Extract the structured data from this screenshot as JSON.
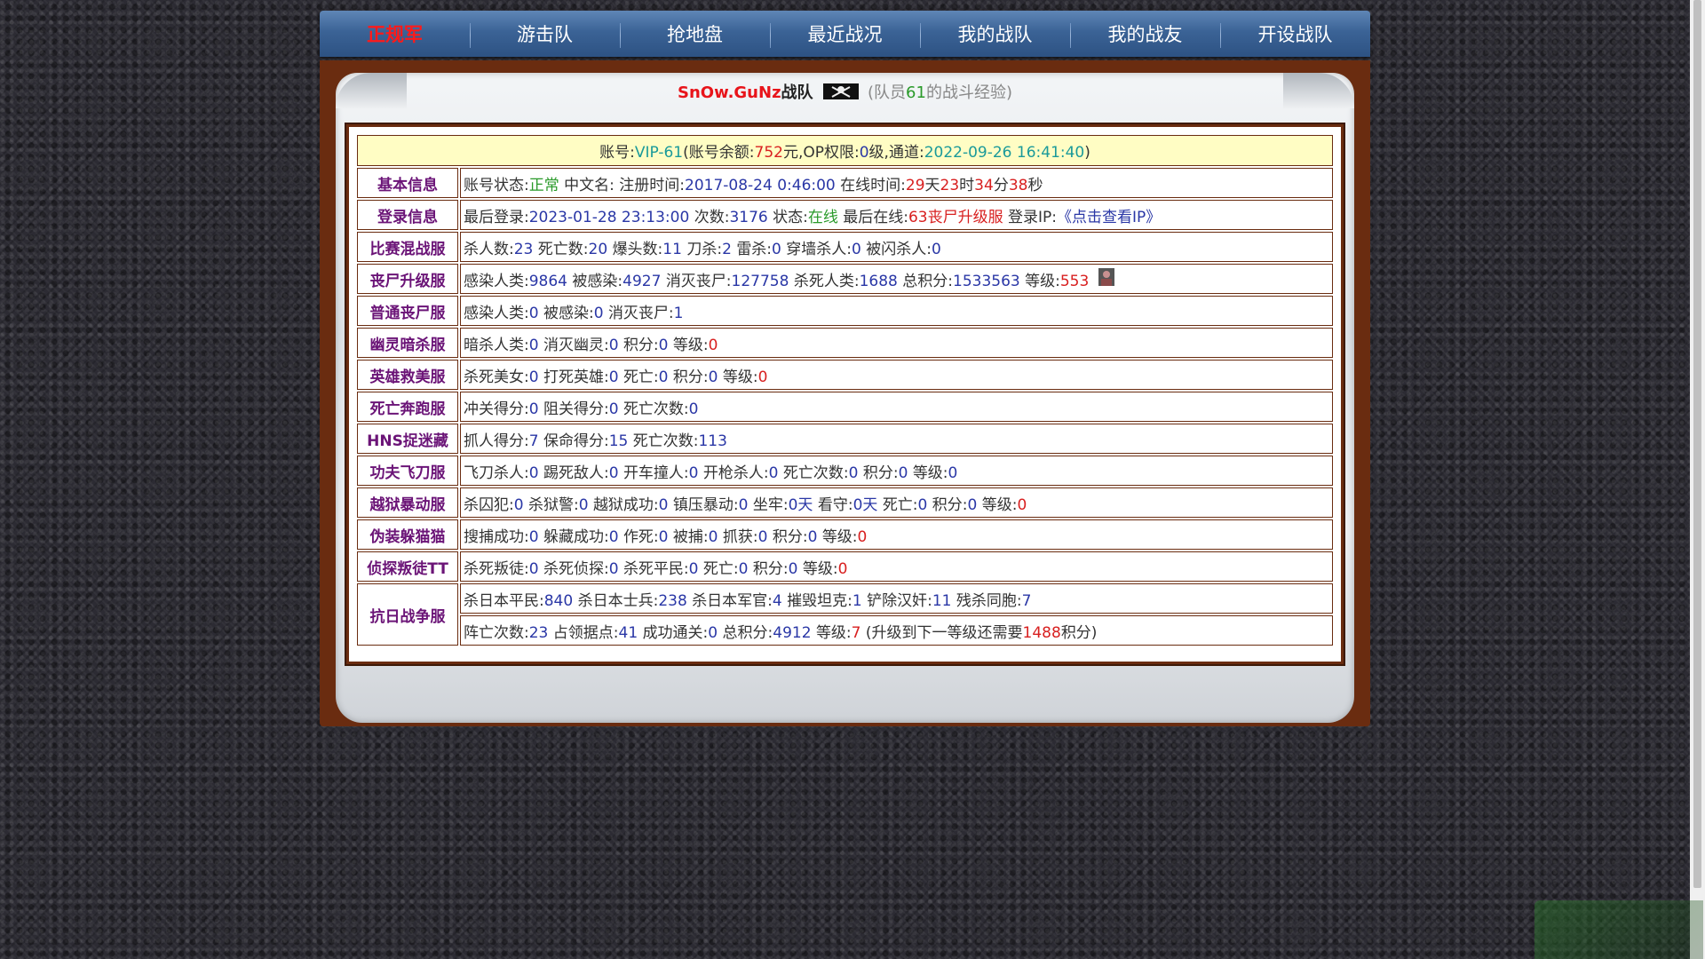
{
  "nav": {
    "items": [
      "正规军",
      "游击队",
      "抢地盘",
      "最近战况",
      "我的战队",
      "我的战友",
      "开设战队"
    ],
    "active_index": 0
  },
  "team": {
    "name": "SnOw.GuNz",
    "suffix": "战队",
    "info_prefix": "(队员",
    "member_id": "61",
    "info_suffix": "的战斗经验)"
  },
  "account": {
    "label1": "账号:",
    "account_id": "VIP-61",
    "label2": "(账号余额:",
    "balance": "752",
    "label3": "元,OP权限:",
    "op_level": "0",
    "label4": "级,通道:",
    "channel_time": "2022-09-26 16:41:40",
    "label5": ")"
  },
  "basic": {
    "caption": "基本信息",
    "status_label": "账号状态:",
    "status": "正常",
    "cn_name_label": "中文名:",
    "reg_label": "注册时间:",
    "reg_time": "2017-08-24 0:46:00",
    "online_label": "在线时间:",
    "days": "29",
    "days_unit": "天",
    "hours": "23",
    "hours_unit": "时",
    "minutes": "34",
    "minutes_unit": "分",
    "seconds": "38",
    "seconds_unit": "秒"
  },
  "login": {
    "caption": "登录信息",
    "last_label": "最后登录:",
    "last_time": "2023-01-28 23:13:00",
    "count_label": "次数:",
    "count": "3176",
    "state_label": "状态:",
    "state": "在线",
    "last_online_label": "最后在线:",
    "last_online": "63丧尸升级服",
    "ip_label": "登录IP:",
    "ip_link": "《点击查看IP》"
  },
  "rows": [
    {
      "caption": "比赛混战服",
      "fields": [
        {
          "label": "杀人数:",
          "value": "23"
        },
        {
          "label": "死亡数:",
          "value": "20"
        },
        {
          "label": "爆头数:",
          "value": "11"
        },
        {
          "label": "刀杀:",
          "value": "2"
        },
        {
          "label": "雷杀:",
          "value": "0"
        },
        {
          "label": "穿墙杀人:",
          "value": "0"
        },
        {
          "label": "被闪杀人:",
          "value": "0"
        }
      ]
    },
    {
      "caption": "丧尸升级服",
      "fields": [
        {
          "label": "感染人类:",
          "value": "9864"
        },
        {
          "label": "被感染:",
          "value": "4927"
        },
        {
          "label": "消灭丧尸:",
          "value": "127758"
        },
        {
          "label": "杀死人类:",
          "value": "1688"
        },
        {
          "label": "总积分:",
          "value": "1533563"
        },
        {
          "label": "等级:",
          "value": "553",
          "red": true
        }
      ],
      "icon": true
    },
    {
      "caption": "普通丧尸服",
      "fields": [
        {
          "label": "感染人类:",
          "value": "0"
        },
        {
          "label": "被感染:",
          "value": "0"
        },
        {
          "label": "消灭丧尸:",
          "value": "1"
        }
      ]
    },
    {
      "caption": "幽灵暗杀服",
      "fields": [
        {
          "label": "暗杀人类:",
          "value": "0"
        },
        {
          "label": "消灭幽灵:",
          "value": "0"
        },
        {
          "label": "积分:",
          "value": "0"
        },
        {
          "label": "等级:",
          "value": "0",
          "red": true
        }
      ]
    },
    {
      "caption": "英雄救美服",
      "fields": [
        {
          "label": "杀死美女:",
          "value": "0"
        },
        {
          "label": "打死英雄:",
          "value": "0"
        },
        {
          "label": "死亡:",
          "value": "0"
        },
        {
          "label": "积分:",
          "value": "0"
        },
        {
          "label": "等级:",
          "value": "0",
          "red": true
        }
      ]
    },
    {
      "caption": "死亡奔跑服",
      "fields": [
        {
          "label": "冲关得分:",
          "value": "0"
        },
        {
          "label": "阻关得分:",
          "value": "0"
        },
        {
          "label": "死亡次数:",
          "value": "0"
        }
      ]
    },
    {
      "caption": "HNS捉迷藏",
      "fields": [
        {
          "label": "抓人得分:",
          "value": "7"
        },
        {
          "label": "保命得分:",
          "value": "15"
        },
        {
          "label": "死亡次数:",
          "value": "113"
        }
      ]
    },
    {
      "caption": "功夫飞刀服",
      "fields": [
        {
          "label": "飞刀杀人:",
          "value": "0"
        },
        {
          "label": "踢死敌人:",
          "value": "0"
        },
        {
          "label": "开车撞人:",
          "value": "0"
        },
        {
          "label": "开枪杀人:",
          "value": "0"
        },
        {
          "label": "死亡次数:",
          "value": "0"
        },
        {
          "label": "积分:",
          "value": "0"
        },
        {
          "label": "等级:",
          "value": "0"
        }
      ]
    },
    {
      "caption": "越狱暴动服",
      "fields": [
        {
          "label": "杀囚犯:",
          "value": "0"
        },
        {
          "label": "杀狱警:",
          "value": "0"
        },
        {
          "label": "越狱成功:",
          "value": "0"
        },
        {
          "label": "镇压暴动:",
          "value": "0"
        },
        {
          "label": "坐牢:",
          "value": "0天"
        },
        {
          "label": "看守:",
          "value": "0天"
        },
        {
          "label": "死亡:",
          "value": "0"
        },
        {
          "label": "积分:",
          "value": "0"
        },
        {
          "label": "等级:",
          "value": "0",
          "red": true
        }
      ]
    },
    {
      "caption": "伪装躲猫猫",
      "fields": [
        {
          "label": "搜捕成功:",
          "value": "0"
        },
        {
          "label": "躲藏成功:",
          "value": "0"
        },
        {
          "label": "作死:",
          "value": "0"
        },
        {
          "label": "被捕:",
          "value": "0"
        },
        {
          "label": "抓获:",
          "value": "0"
        },
        {
          "label": "积分:",
          "value": "0"
        },
        {
          "label": "等级:",
          "value": "0",
          "red": true
        }
      ]
    },
    {
      "caption": "侦探叛徒TT",
      "fields": [
        {
          "label": "杀死叛徒:",
          "value": "0"
        },
        {
          "label": "杀死侦探:",
          "value": "0"
        },
        {
          "label": "杀死平民:",
          "value": "0"
        },
        {
          "label": "死亡:",
          "value": "0"
        },
        {
          "label": "积分:",
          "value": "0"
        },
        {
          "label": "等级:",
          "value": "0",
          "red": true
        }
      ]
    }
  ],
  "anti_japan": {
    "caption": "抗日战争服",
    "line1": [
      {
        "label": "杀日本平民:",
        "value": "840"
      },
      {
        "label": "杀日本士兵:",
        "value": "238"
      },
      {
        "label": "杀日本军官:",
        "value": "4"
      },
      {
        "label": "摧毁坦克:",
        "value": "1"
      },
      {
        "label": "铲除汉奸:",
        "value": "11"
      },
      {
        "label": "残杀同胞:",
        "value": "7"
      }
    ],
    "line2": [
      {
        "label": "阵亡次数:",
        "value": "23"
      },
      {
        "label": "占领据点:",
        "value": "41"
      },
      {
        "label": "成功通关:",
        "value": "0"
      },
      {
        "label": "总积分:",
        "value": "4912"
      },
      {
        "label": "等级:",
        "value": "7",
        "red": true
      }
    ],
    "upgrade_prefix": "(升级到下一等级还需要",
    "upgrade_points": "1488",
    "upgrade_suffix": "积分)"
  }
}
